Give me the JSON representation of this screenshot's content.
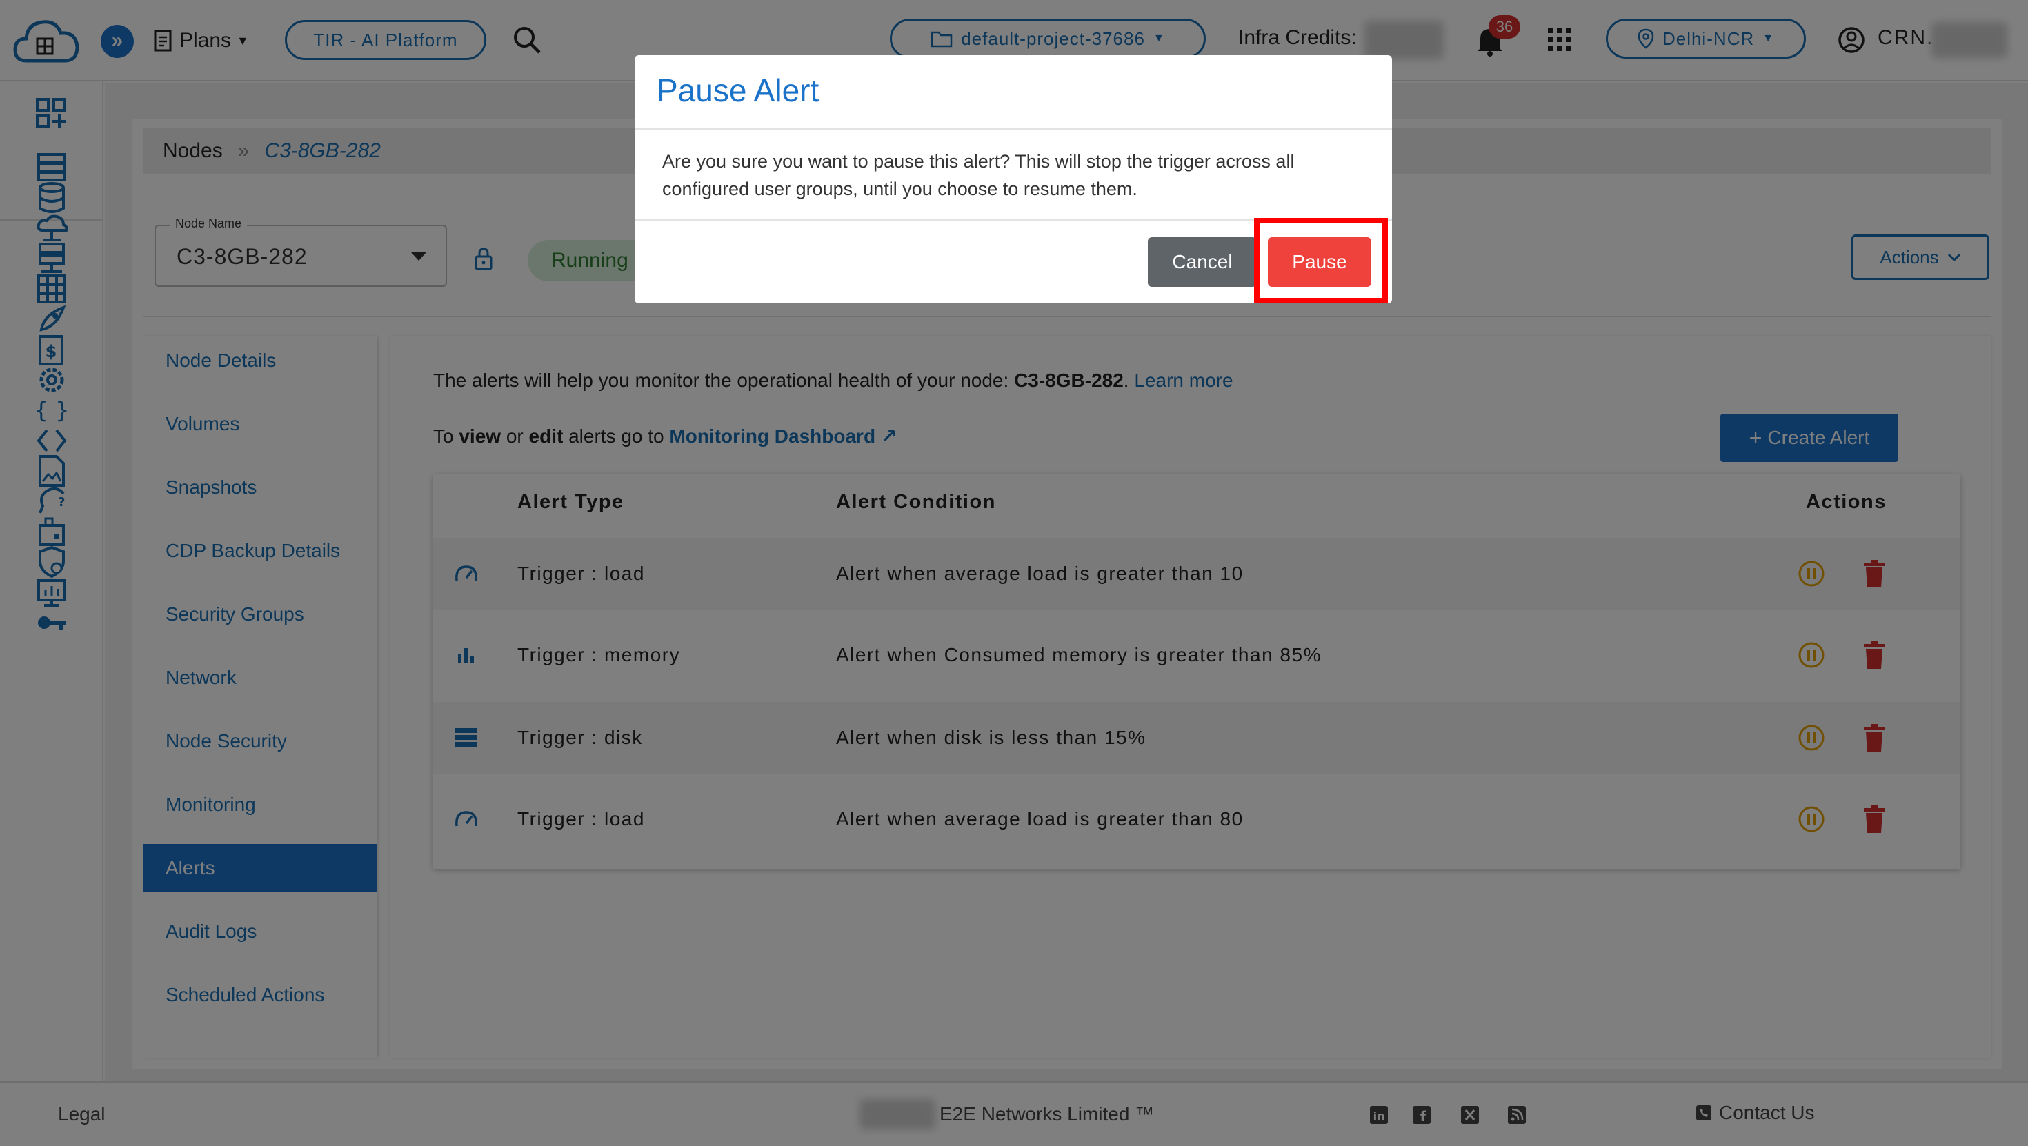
{
  "header": {
    "plans_label": "Plans",
    "tir_label": "TIR - AI Platform",
    "project_label": "default-project-37686",
    "infra_credits_label": "Infra Credits:",
    "notification_count": "36",
    "region_label": "Delhi-NCR",
    "crn_label": "CRN."
  },
  "breadcrumb": {
    "root": "Nodes",
    "separator": "»",
    "current": "C3-8GB-282"
  },
  "node": {
    "name_label": "Node Name",
    "name_value": "C3-8GB-282",
    "status": "Running"
  },
  "toolbar": {
    "actions_label": "Actions"
  },
  "subnav": {
    "items": [
      "Node Details",
      "Volumes",
      "Snapshots",
      "CDP Backup Details",
      "Security Groups",
      "Network",
      "Node Security",
      "Monitoring",
      "Alerts",
      "Audit Logs",
      "Scheduled Actions"
    ]
  },
  "alerts": {
    "info_prefix": "The alerts will help you monitor the operational health of your node:",
    "info_node": "C3-8GB-282",
    "info_dot": ".",
    "learn_more": "Learn more",
    "to_label": "To",
    "view_label": "view",
    "or_label": "or",
    "edit_label": "edit",
    "goto_label": "alerts go to",
    "monitoring_link": "Monitoring Dashboard",
    "create_button": "Create Alert",
    "columns": {
      "type": "Alert Type",
      "condition": "Alert Condition",
      "actions": "Actions"
    },
    "rows": [
      {
        "icon": "gauge-icon",
        "type": "Trigger : load",
        "condition": "Alert when average load is greater than 10"
      },
      {
        "icon": "bar-chart-icon",
        "type": "Trigger : memory",
        "condition": "Alert when Consumed memory is greater than 85%"
      },
      {
        "icon": "storage-icon",
        "type": "Trigger : disk",
        "condition": "Alert when disk is less than 15%"
      },
      {
        "icon": "gauge-icon",
        "type": "Trigger : load",
        "condition": "Alert when average load is greater than 80"
      }
    ]
  },
  "footer": {
    "legal": "Legal",
    "copyright": "E2E Networks Limited ™",
    "contact": "Contact Us"
  },
  "modal": {
    "title": "Pause Alert",
    "body": "Are you sure you want to pause this alert? This will stop the trigger across all configured user groups, until you choose to resume them.",
    "cancel_label": "Cancel",
    "pause_label": "Pause"
  },
  "colors": {
    "primary": "#1a73c9",
    "danger": "#f0423d",
    "highlight": "#ff0000",
    "warning": "#e0a000",
    "delete": "#d32f2f"
  }
}
